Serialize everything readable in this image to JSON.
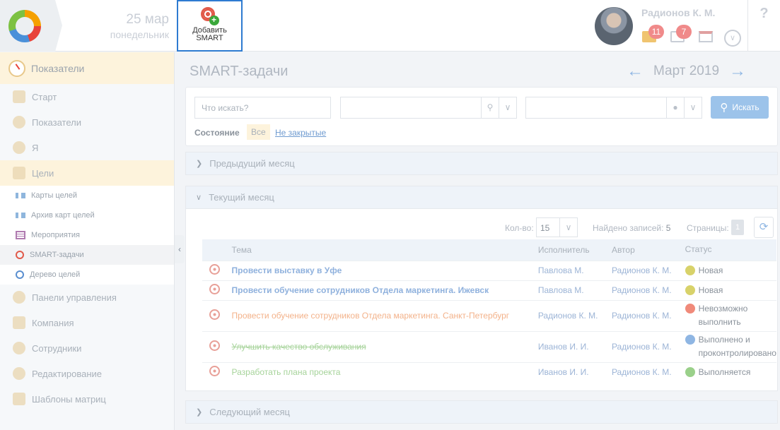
{
  "header": {
    "date_day": "25 мар",
    "date_weekday": "понедельник",
    "add_smart_label": "Добавить SMART",
    "user_name": "Радионов К. М.",
    "mail_count": "11",
    "task_count": "7",
    "help_label": "?"
  },
  "sidebar": {
    "top_label": "Показатели",
    "items": [
      {
        "label": "Старт"
      },
      {
        "label": "Показатели"
      },
      {
        "label": "Я"
      },
      {
        "label": "Цели"
      }
    ],
    "sub_items": [
      {
        "label": "Карты целей"
      },
      {
        "label": "Архив карт целей"
      },
      {
        "label": "Мероприятия"
      },
      {
        "label": "SMART-задачи"
      },
      {
        "label": "Дерево целей"
      }
    ],
    "bottom_items": [
      {
        "label": "Панели управления"
      },
      {
        "label": "Компания"
      },
      {
        "label": "Сотрудники"
      },
      {
        "label": "Редактирование"
      },
      {
        "label": "Шаблоны матриц"
      }
    ]
  },
  "main": {
    "title": "SMART-задачи",
    "month": "Март 2019",
    "filters": {
      "search_placeholder": "Что искать?",
      "search_button": "Искать",
      "state_label": "Состояние",
      "state_all": "Все",
      "state_open": "Не закрытые"
    },
    "sections": {
      "previous": "Предыдущий месяц",
      "current": "Текущий месяц",
      "next": "Следующий месяц"
    },
    "pager": {
      "qty_label": "Кол-во:",
      "qty_value": "15",
      "found_label": "Найдено записей:",
      "found_value": "5",
      "pages_label": "Страницы:",
      "page_value": "1"
    },
    "table": {
      "headers": {
        "topic": "Тема",
        "executor": "Исполнитель",
        "author": "Автор",
        "status": "Статус"
      },
      "rows": [
        {
          "topic": "Провести выставку в Уфе",
          "executor": "Павлова М.",
          "author": "Радионов К. М.",
          "status": "Новая"
        },
        {
          "topic": "Провести обучение сотрудников Отдела маркетинга. Ижевск",
          "executor": "Павлова М.",
          "author": "Радионов К. М.",
          "status": "Новая"
        },
        {
          "topic": "Провести обучение сотрудников Отдела маркетинга. Санкт-Петербург",
          "executor": "Радионов К. М.",
          "author": "Радионов К. М.",
          "status": "Невозможно выполнить"
        },
        {
          "topic": "Улучшить качество обслуживания",
          "executor": "Иванов И. И.",
          "author": "Радионов К. М.",
          "status": "Выполнено и проконтролировано"
        },
        {
          "topic": "Разработать плана проекта",
          "executor": "Иванов И. И.",
          "author": "Радионов К. М.",
          "status": "Выполняется"
        }
      ]
    }
  }
}
